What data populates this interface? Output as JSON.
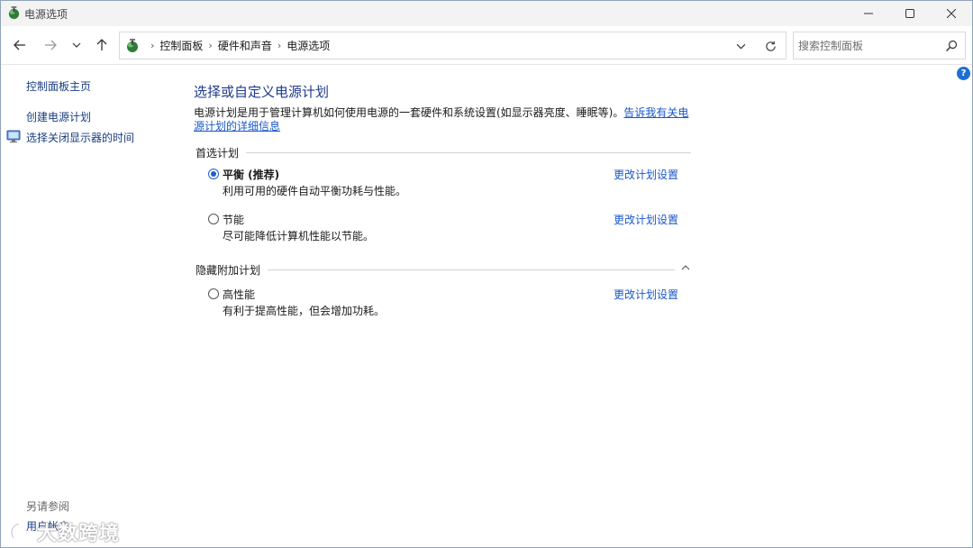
{
  "window": {
    "title": "电源选项"
  },
  "nav": {
    "breadcrumbs": [
      "控制面板",
      "硬件和声音",
      "电源选项"
    ],
    "search_placeholder": "搜索控制面板"
  },
  "left_pane": {
    "home": "控制面板主页",
    "create_plan": "创建电源计划",
    "display_off": "选择关闭显示器的时间",
    "see_also": "另请参阅",
    "user_accounts": "用户帐户"
  },
  "main": {
    "title": "选择或自定义电源计划",
    "description": "电源计划是用于管理计算机如何使用电源的一套硬件和系统设置(如显示器亮度、睡眠等)。",
    "description_link": "告诉我有关电源计划的详细信息",
    "preferred_header": "首选计划",
    "hidden_header": "隐藏附加计划",
    "plans": [
      {
        "name": "平衡 (推荐)",
        "description": "利用可用的硬件自动平衡功耗与性能。",
        "link": "更改计划设置",
        "selected": true
      },
      {
        "name": "节能",
        "description": "尽可能降低计算机性能以节能。",
        "link": "更改计划设置",
        "selected": false
      },
      {
        "name": "高性能",
        "description": "有利于提高性能，但会增加功耗。",
        "link": "更改计划设置",
        "selected": false
      }
    ]
  },
  "watermark": {
    "text": "大数跨境"
  },
  "colors": {
    "accent": "#1f5fc8",
    "title_blue": "#1e3a8a",
    "link_blue": "#1a57c8"
  },
  "icons": [
    "power-options-icon",
    "back-arrow-icon",
    "forward-arrow-icon",
    "chevron-down-icon",
    "up-arrow-icon",
    "refresh-icon",
    "search-icon",
    "help-icon",
    "monitor-icon",
    "chevron-up-icon"
  ]
}
